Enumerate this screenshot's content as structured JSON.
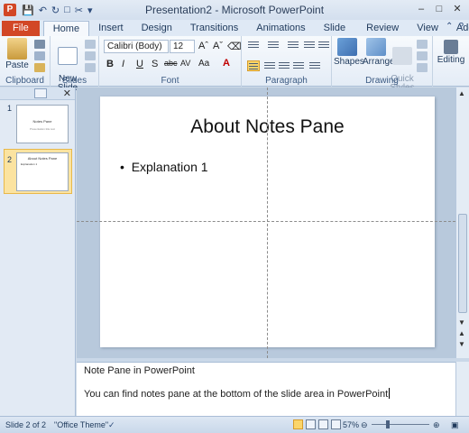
{
  "window": {
    "title": "Presentation2 - Microsoft PowerPoint",
    "app_icon_letter": "P"
  },
  "tabs": [
    "File",
    "Home",
    "Insert",
    "Design",
    "Transitions",
    "Animations",
    "Slide Show",
    "Review",
    "View",
    "Add-Ins"
  ],
  "ribbon": {
    "clipboard": {
      "paste_label": "Paste",
      "group_label": "Clipboard"
    },
    "slides": {
      "new_slide_label": "New\nSlide",
      "group_label": "Slides"
    },
    "font": {
      "font_name": "Calibri (Body)",
      "font_size": "12",
      "group_label": "Font"
    },
    "paragraph": {
      "group_label": "Paragraph"
    },
    "drawing": {
      "shapes_label": "Shapes",
      "arrange_label": "Arrange",
      "quick_styles_label": "Quick\nStyles",
      "group_label": "Drawing"
    },
    "editing": {
      "editing_label": "Editing"
    }
  },
  "thumbnails": [
    {
      "number": "1",
      "title": "Notes Pane",
      "subtitle": "Presentation title text"
    },
    {
      "number": "2",
      "title": "About Notes Pane",
      "subtitle": "Explanation 1"
    }
  ],
  "slide": {
    "title": "About Notes Pane",
    "bullet": "Explanation 1"
  },
  "notes": {
    "line1": "Note Pane in PowerPoint",
    "line2": "You can find notes pane at the bottom of the slide area in PowerPoint"
  },
  "status": {
    "slide_info": "Slide 2 of 2",
    "theme": "\"Office Theme\"",
    "zoom": "57%"
  },
  "colors": {
    "file_tab": "#d24726",
    "selection": "#fbe3a0"
  }
}
